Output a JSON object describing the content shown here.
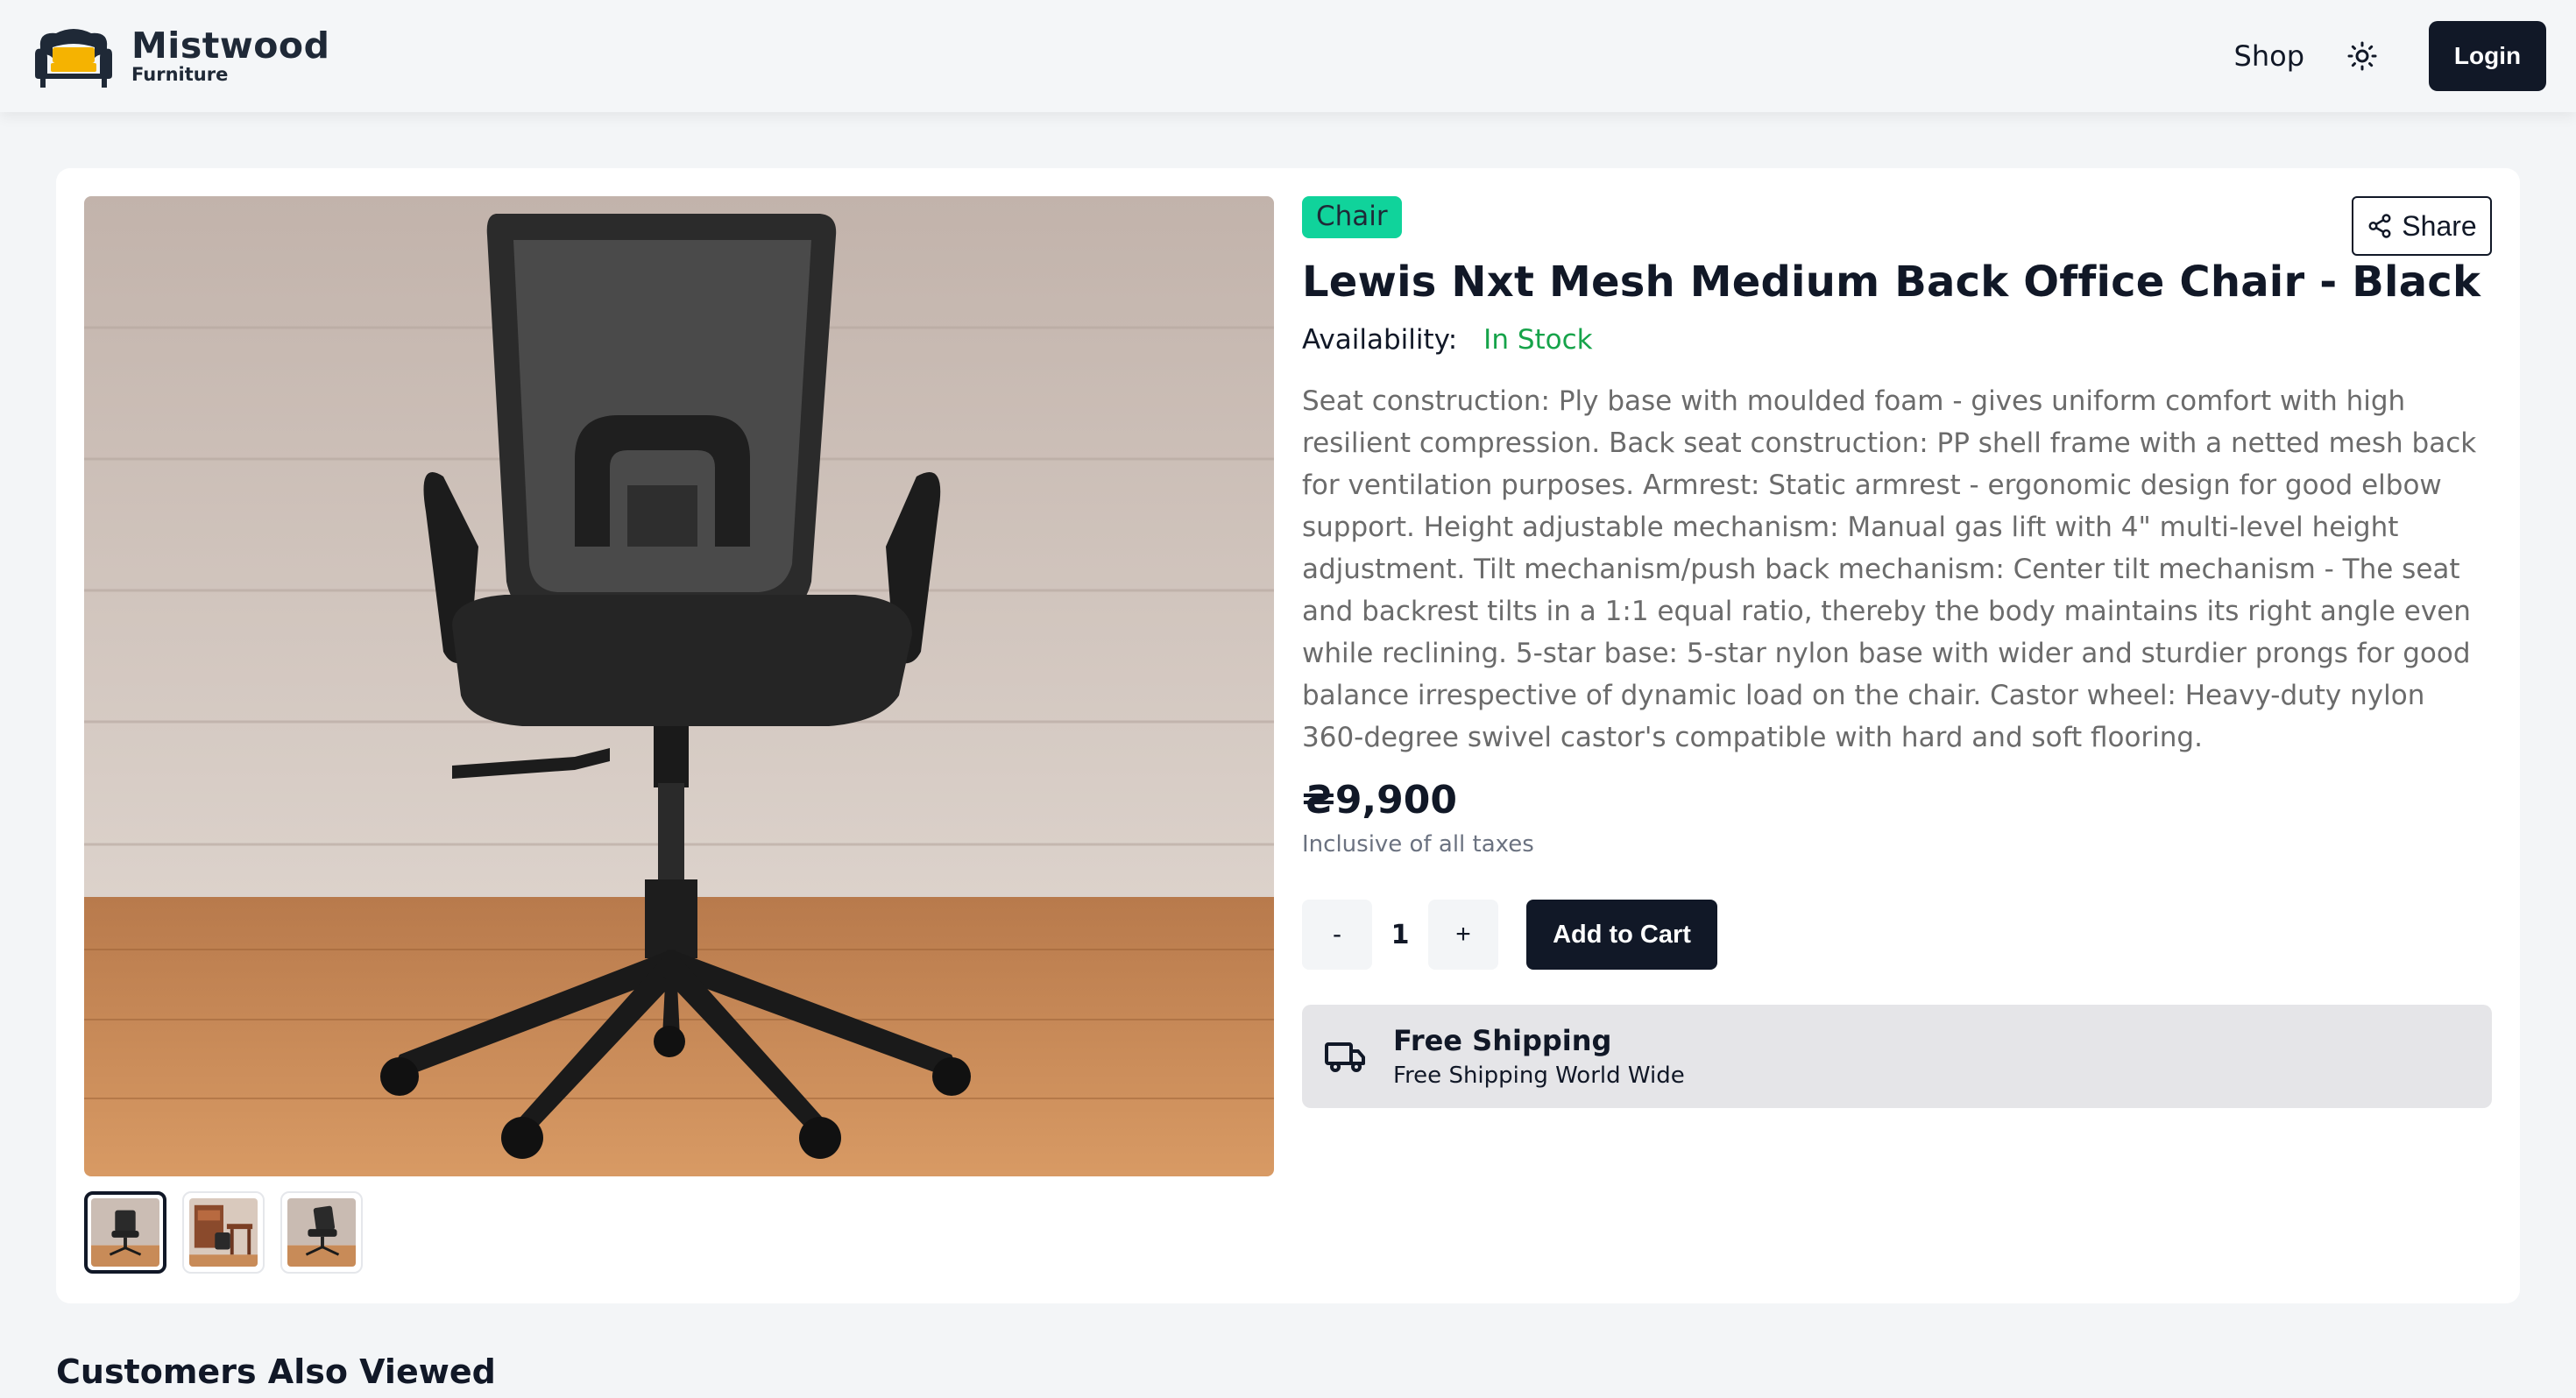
{
  "header": {
    "brand_name": "Mistwood",
    "brand_sub": "Furniture",
    "nav_shop": "Shop",
    "login_label": "Login"
  },
  "product": {
    "category": "Chair",
    "share_label": "Share",
    "title": "Lewis Nxt Mesh Medium Back Office Chair - Black",
    "availability_label": "Availability:",
    "availability_value": "In Stock",
    "description": "Seat construction: Ply base with moulded foam - gives uniform comfort with high resilient compression. Back seat construction: PP shell frame with a netted mesh back for ventilation purposes. Armrest: Static armrest - ergonomic design for good elbow support. Height adjustable mechanism: Manual gas lift with 4\" multi-level height adjustment. Tilt mechanism/push back mechanism: Center tilt mechanism - The seat and backrest tilts in a 1:1 equal ratio, thereby the body maintains its right angle even while reclining. 5-star base: 5-star nylon base with wider and sturdier prongs for good balance irrespective of dynamic load on the chair. Castor wheel: Heavy-duty nylon 360-degree swivel castor's compatible with hard and soft flooring.",
    "price": "₴9,900",
    "tax_note": "Inclusive of all taxes",
    "quantity": "1",
    "qty_minus": "-",
    "qty_plus": "+",
    "add_to_cart": "Add to Cart",
    "shipping_title": "Free Shipping",
    "shipping_sub": "Free Shipping World Wide",
    "thumbnails": [
      "thumbnail-1",
      "thumbnail-2",
      "thumbnail-3"
    ],
    "active_thumbnail": 0
  },
  "sections": {
    "also_viewed": "Customers Also Viewed"
  },
  "colors": {
    "primary": "#111827",
    "badge": "#10d39b",
    "in_stock": "#16a34a",
    "background": "#f3f5f7"
  },
  "icons": [
    "sofa-logo-icon",
    "sun-icon",
    "share-icon",
    "truck-icon"
  ]
}
